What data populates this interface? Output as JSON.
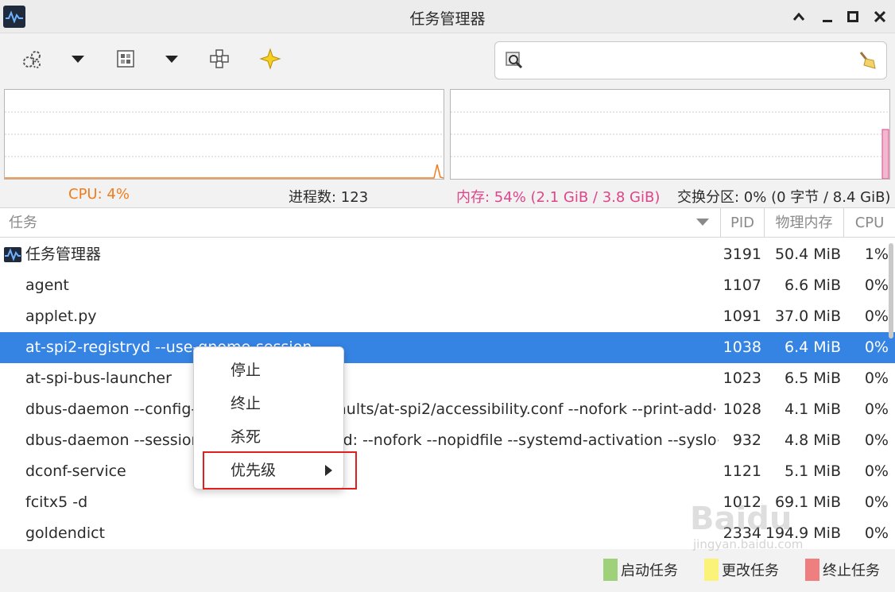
{
  "window": {
    "title": "任务管理器"
  },
  "toolbar": {
    "icons": [
      "settings-gears-icon",
      "dropdown-icon",
      "view-icon",
      "dropdown-icon",
      "crosshair-icon",
      "star-icon"
    ],
    "search_placeholder": ""
  },
  "graphs": {
    "cpu_color": "#f27c1c",
    "mem_color": "#e0448a"
  },
  "stats": {
    "cpu": "CPU: 4%",
    "processes": "进程数: 123",
    "memory": "内存: 54% (2.1 GiB / 3.8 GiB)",
    "swap": "交换分区: 0% (0 字节 / 8.4 GiB)"
  },
  "table": {
    "headers": {
      "task": "任务",
      "pid": "PID",
      "memory": "物理内存",
      "cpu": "CPU"
    },
    "rows": [
      {
        "name": "任务管理器",
        "pid": "3191",
        "mem": "50.4 MiB",
        "cpu": "1%"
      },
      {
        "name": "agent",
        "pid": "1107",
        "mem": "6.6 MiB",
        "cpu": "0%"
      },
      {
        "name": "applet.py",
        "pid": "1091",
        "mem": "37.0 MiB",
        "cpu": "0%"
      },
      {
        "name": "at-spi2-registryd --use-gnome-session",
        "pid": "1038",
        "mem": "6.4 MiB",
        "cpu": "0%"
      },
      {
        "name": "at-spi-bus-launcher",
        "pid": "1023",
        "mem": "6.5 MiB",
        "cpu": "0%"
      },
      {
        "name": "dbus-daemon --config-file=/usr/share/defaults/at-spi2/accessibility.conf --nofork --print-add⋯",
        "pid": "1028",
        "mem": "4.1 MiB",
        "cpu": "0%"
      },
      {
        "name": "dbus-daemon --session --address=systemd: --nofork --nopidfile --systemd-activation --syslo⋯",
        "pid": "932",
        "mem": "4.8 MiB",
        "cpu": "0%"
      },
      {
        "name": "dconf-service",
        "pid": "1121",
        "mem": "5.1 MiB",
        "cpu": "0%"
      },
      {
        "name": "fcitx5 -d",
        "pid": "1012",
        "mem": "69.1 MiB",
        "cpu": "0%"
      },
      {
        "name": "goldendict",
        "pid": "2334",
        "mem": "194.9 MiB",
        "cpu": "0%"
      }
    ]
  },
  "context_menu": {
    "items": [
      "停止",
      "终止",
      "杀死",
      "优先级"
    ]
  },
  "legend": {
    "start": "启动任务",
    "change": "更改任务",
    "end": "终止任务",
    "start_color": "#9fd07a",
    "change_color": "#fbf27a",
    "end_color": "#ef7e80"
  },
  "watermark": {
    "text": "Baidu",
    "sub": "jingyan.baidu.com"
  }
}
